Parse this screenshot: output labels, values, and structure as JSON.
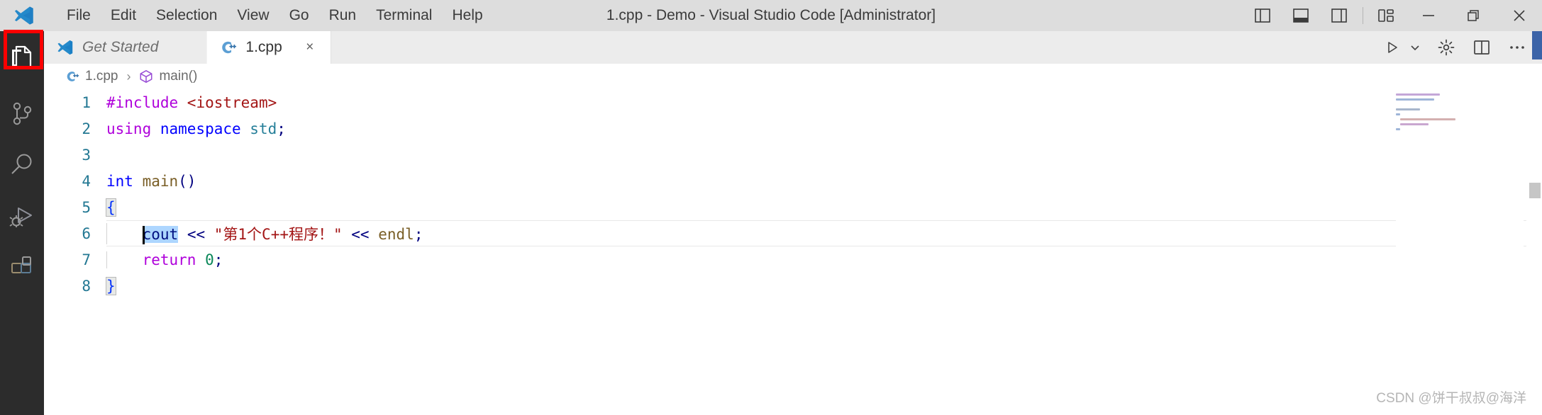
{
  "window": {
    "title": "1.cpp - Demo - Visual Studio Code [Administrator]",
    "logo_icon": "vscode-logo-icon"
  },
  "menubar": {
    "items": [
      {
        "label": "File"
      },
      {
        "label": "Edit"
      },
      {
        "label": "Selection"
      },
      {
        "label": "View"
      },
      {
        "label": "Go"
      },
      {
        "label": "Run"
      },
      {
        "label": "Terminal"
      },
      {
        "label": "Help"
      }
    ]
  },
  "titlebar_actions": {
    "toggle_primary_sidebar": "toggle-primary-sidebar-icon",
    "toggle_panel": "toggle-panel-icon",
    "toggle_secondary_sidebar": "toggle-secondary-sidebar-icon",
    "customize_layout": "customize-layout-icon",
    "minimize": "minimize-icon",
    "maximize": "maximize-restore-icon",
    "close": "close-icon"
  },
  "activitybar": {
    "items": [
      {
        "name": "explorer",
        "icon": "files-explorer-icon",
        "active": true,
        "highlighted": true
      },
      {
        "name": "source-control",
        "icon": "source-control-branch-icon",
        "active": false,
        "highlighted": false
      },
      {
        "name": "search",
        "icon": "search-magnifier-icon",
        "active": false,
        "highlighted": false
      },
      {
        "name": "run-and-debug",
        "icon": "run-and-debug-icon",
        "active": false,
        "highlighted": false
      },
      {
        "name": "extensions",
        "icon": "extensions-blocks-icon",
        "active": false,
        "highlighted": false
      }
    ],
    "highlight_color": "#fd0000"
  },
  "tabs": [
    {
      "label": "Get Started",
      "icon": "vscode-logo-icon",
      "active": false,
      "italic": true,
      "closable": false
    },
    {
      "label": "1.cpp",
      "icon": "cpp-file-icon",
      "active": true,
      "italic": false,
      "closable": true,
      "close_label": "×"
    }
  ],
  "editor_actions": [
    {
      "name": "run-code",
      "icon": "play-triangle-icon",
      "label": "▷"
    },
    {
      "name": "run-options-dropdown",
      "icon": "chevron-down-icon",
      "label": "⌄"
    },
    {
      "name": "run-settings",
      "icon": "gear-icon"
    },
    {
      "name": "split-editor-right",
      "icon": "split-editor-icon"
    },
    {
      "name": "more-actions",
      "icon": "ellipsis-icon",
      "label": "⋯"
    }
  ],
  "breadcrumb": {
    "items": [
      {
        "label": "1.cpp",
        "icon": "cpp-file-icon"
      },
      {
        "label": "main()",
        "icon": "symbol-method-cube-icon"
      }
    ],
    "separator": "›"
  },
  "code": {
    "language": "cpp",
    "active_line": 6,
    "line_numbers": [
      "1",
      "2",
      "3",
      "4",
      "5",
      "6",
      "7",
      "8"
    ],
    "lines": [
      {
        "n": "1",
        "tokens": [
          {
            "t": "#include ",
            "c": "t-pre"
          },
          {
            "t": "<iostream>",
            "c": "t-inc"
          }
        ]
      },
      {
        "n": "2",
        "tokens": [
          {
            "t": "using ",
            "c": "t-kw2"
          },
          {
            "t": "namespace ",
            "c": "t-key"
          },
          {
            "t": "std",
            "c": "t-type"
          },
          {
            "t": ";",
            "c": "t-op"
          }
        ]
      },
      {
        "n": "3",
        "tokens": []
      },
      {
        "n": "4",
        "tokens": [
          {
            "t": "int ",
            "c": "t-key"
          },
          {
            "t": "main",
            "c": "t-fn"
          },
          {
            "t": "()",
            "c": "t-op"
          }
        ]
      },
      {
        "n": "5",
        "tokens": [
          {
            "t": "{",
            "c": "t-brace bracket-hl"
          }
        ]
      },
      {
        "n": "6",
        "tokens": [
          {
            "t": "    ",
            "c": ""
          },
          {
            "t": "cout",
            "c": "t-var sel"
          },
          {
            "t": " ",
            "c": ""
          },
          {
            "t": "<<",
            "c": "t-op"
          },
          {
            "t": " ",
            "c": ""
          },
          {
            "t": "\"第1个C++程序！\"",
            "c": "t-str"
          },
          {
            "t": " ",
            "c": ""
          },
          {
            "t": "<<",
            "c": "t-op"
          },
          {
            "t": " ",
            "c": ""
          },
          {
            "t": "endl",
            "c": "t-fn"
          },
          {
            "t": ";",
            "c": "t-op"
          }
        ]
      },
      {
        "n": "7",
        "tokens": [
          {
            "t": "    ",
            "c": ""
          },
          {
            "t": "return ",
            "c": "t-kw2"
          },
          {
            "t": "0",
            "c": "t-num"
          },
          {
            "t": ";",
            "c": "t-op"
          }
        ]
      },
      {
        "n": "8",
        "tokens": [
          {
            "t": "}",
            "c": "t-brace bracket-hl"
          }
        ]
      }
    ]
  },
  "watermark": {
    "text": "CSDN @饼干叔叔@海洋"
  },
  "colors": {
    "titlebar_bg": "#dddddd",
    "activitybar_bg": "#2c2c2c",
    "editor_bg": "#ffffff",
    "tab_inactive_bg": "#ececec",
    "tab_active_bg": "#ffffff",
    "line_number": "#237893",
    "selection": "#add6ff",
    "accent_blue": "#0078d4"
  }
}
